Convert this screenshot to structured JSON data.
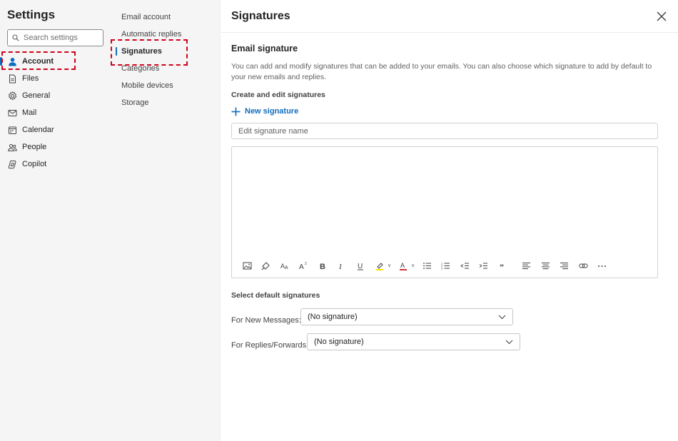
{
  "settings": {
    "title": "Settings",
    "search_placeholder": "Search settings"
  },
  "nav": {
    "items": [
      {
        "label": "Account",
        "icon": "person-icon",
        "active": true
      },
      {
        "label": "Files",
        "icon": "file-icon"
      },
      {
        "label": "General",
        "icon": "gear-icon"
      },
      {
        "label": "Mail",
        "icon": "mail-icon"
      },
      {
        "label": "Calendar",
        "icon": "calendar-icon"
      },
      {
        "label": "People",
        "icon": "people-icon"
      },
      {
        "label": "Copilot",
        "icon": "copilot-icon"
      }
    ]
  },
  "subnav": {
    "items": [
      {
        "label": "Email account"
      },
      {
        "label": "Automatic replies"
      },
      {
        "label": "Signatures",
        "active": true
      },
      {
        "label": "Categories"
      },
      {
        "label": "Mobile devices"
      },
      {
        "label": "Storage"
      }
    ]
  },
  "main": {
    "title": "Signatures",
    "section_title": "Email signature",
    "description": "You can add and modify signatures that can be added to your emails. You can also choose which signature to add by default to your new emails and replies.",
    "create_label": "Create and edit signatures",
    "new_signature_label": "New signature",
    "name_placeholder": "Edit signature name",
    "toolbar": [
      "insert-picture-icon",
      "format-painter-icon",
      "font-size-icon",
      "superscript-icon",
      "bold-icon",
      "italic-icon",
      "underline-icon",
      "highlight-icon",
      "font-color-icon",
      "bullets-icon",
      "numbering-icon",
      "decrease-indent-icon",
      "increase-indent-icon",
      "quote-icon",
      "align-left-icon",
      "align-center-icon",
      "align-right-icon",
      "link-icon",
      "more-icon"
    ],
    "default_title": "Select default signatures",
    "new_messages_label": "For New Messages:",
    "new_messages_value": "(No signature)",
    "replies_label": "For Replies/Forwards:",
    "replies_value": "(No signature)"
  },
  "colors": {
    "accent": "#0f6cbd",
    "highlight_box": "#d0021b",
    "highlight_yellow": "#fce100",
    "font_color_red": "#d13438"
  }
}
